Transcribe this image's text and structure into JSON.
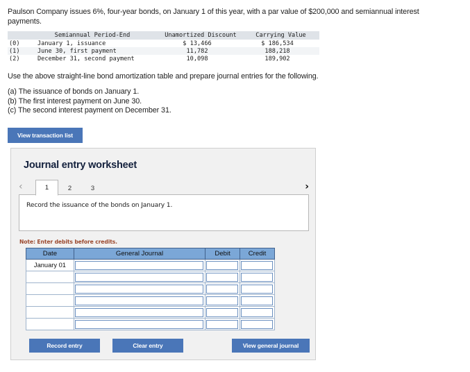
{
  "problem": {
    "intro": "Paulson Company issues 6%, four-year bonds, on January 1 of this year, with a par value of $200,000 and semiannual interest payments.",
    "instruction": "Use the above straight-line bond amortization table and prepare journal entries for the following.",
    "requirements": [
      "(a) The issuance of bonds on January 1.",
      "(b) The first interest payment on June 30.",
      "(c) The second interest payment on December 31."
    ]
  },
  "amortization_table": {
    "columns": [
      "",
      "Semiannual Period-End",
      "Unamortized Discount",
      "Carrying Value"
    ],
    "rows": [
      {
        "index": "(0)",
        "period": "January 1, issuance",
        "discount": "$ 13,466",
        "carrying": "$ 186,534"
      },
      {
        "index": "(1)",
        "period": "June 30, first payment",
        "discount": "11,782",
        "carrying": "188,218"
      },
      {
        "index": "(2)",
        "period": "December 31, second payment",
        "discount": "10,098",
        "carrying": "189,902"
      }
    ]
  },
  "toolbar": {
    "view_transaction_list_label": "View transaction list"
  },
  "worksheet": {
    "title": "Journal entry worksheet",
    "tabs": [
      {
        "label": "1",
        "active": true
      },
      {
        "label": "2",
        "active": false
      },
      {
        "label": "3",
        "active": false
      }
    ],
    "prev_label": "‹",
    "next_label": "›",
    "prompt": "Record the issuance of the bonds on January 1.",
    "note": "Note: Enter debits before credits.",
    "journal": {
      "headers": [
        "Date",
        "General Journal",
        "Debit",
        "Credit"
      ],
      "rows": [
        {
          "date": "January 01",
          "account": "",
          "debit": "",
          "credit": ""
        },
        {
          "date": "",
          "account": "",
          "debit": "",
          "credit": ""
        },
        {
          "date": "",
          "account": "",
          "debit": "",
          "credit": ""
        },
        {
          "date": "",
          "account": "",
          "debit": "",
          "credit": ""
        },
        {
          "date": "",
          "account": "",
          "debit": "",
          "credit": ""
        },
        {
          "date": "",
          "account": "",
          "debit": "",
          "credit": ""
        }
      ]
    },
    "buttons": {
      "record_entry": "Record entry",
      "clear_entry": "Clear entry",
      "view_general_journal": "View general journal"
    }
  },
  "colors": {
    "button_blue": "#4a76b8",
    "table_header_blue": "#7ba7d7",
    "note_red": "#9c4a2f",
    "panel_bg": "#f1f1f1"
  }
}
